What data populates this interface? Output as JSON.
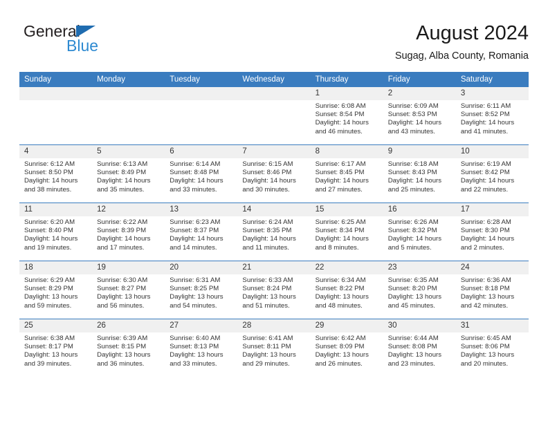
{
  "brand": {
    "name_line1": "General",
    "name_line2": "Blue",
    "triangle_color": "#1f6cb0",
    "blue_text_color": "#2e8ad1"
  },
  "header": {
    "title": "August 2024",
    "subtitle": "Sugag, Alba County, Romania",
    "header_bg_color": "#3a7cbf",
    "daynum_bg_color": "#f0f0f0"
  },
  "weekday_headers": [
    "Sunday",
    "Monday",
    "Tuesday",
    "Wednesday",
    "Thursday",
    "Friday",
    "Saturday"
  ],
  "weeks": [
    [
      {
        "day": "",
        "empty": true
      },
      {
        "day": "",
        "empty": true
      },
      {
        "day": "",
        "empty": true
      },
      {
        "day": "",
        "empty": true
      },
      {
        "day": "1",
        "sunrise": "Sunrise: 6:08 AM",
        "sunset": "Sunset: 8:54 PM",
        "daylight_line1": "Daylight: 14 hours",
        "daylight_line2": "and 46 minutes."
      },
      {
        "day": "2",
        "sunrise": "Sunrise: 6:09 AM",
        "sunset": "Sunset: 8:53 PM",
        "daylight_line1": "Daylight: 14 hours",
        "daylight_line2": "and 43 minutes."
      },
      {
        "day": "3",
        "sunrise": "Sunrise: 6:11 AM",
        "sunset": "Sunset: 8:52 PM",
        "daylight_line1": "Daylight: 14 hours",
        "daylight_line2": "and 41 minutes."
      }
    ],
    [
      {
        "day": "4",
        "sunrise": "Sunrise: 6:12 AM",
        "sunset": "Sunset: 8:50 PM",
        "daylight_line1": "Daylight: 14 hours",
        "daylight_line2": "and 38 minutes."
      },
      {
        "day": "5",
        "sunrise": "Sunrise: 6:13 AM",
        "sunset": "Sunset: 8:49 PM",
        "daylight_line1": "Daylight: 14 hours",
        "daylight_line2": "and 35 minutes."
      },
      {
        "day": "6",
        "sunrise": "Sunrise: 6:14 AM",
        "sunset": "Sunset: 8:48 PM",
        "daylight_line1": "Daylight: 14 hours",
        "daylight_line2": "and 33 minutes."
      },
      {
        "day": "7",
        "sunrise": "Sunrise: 6:15 AM",
        "sunset": "Sunset: 8:46 PM",
        "daylight_line1": "Daylight: 14 hours",
        "daylight_line2": "and 30 minutes."
      },
      {
        "day": "8",
        "sunrise": "Sunrise: 6:17 AM",
        "sunset": "Sunset: 8:45 PM",
        "daylight_line1": "Daylight: 14 hours",
        "daylight_line2": "and 27 minutes."
      },
      {
        "day": "9",
        "sunrise": "Sunrise: 6:18 AM",
        "sunset": "Sunset: 8:43 PM",
        "daylight_line1": "Daylight: 14 hours",
        "daylight_line2": "and 25 minutes."
      },
      {
        "day": "10",
        "sunrise": "Sunrise: 6:19 AM",
        "sunset": "Sunset: 8:42 PM",
        "daylight_line1": "Daylight: 14 hours",
        "daylight_line2": "and 22 minutes."
      }
    ],
    [
      {
        "day": "11",
        "sunrise": "Sunrise: 6:20 AM",
        "sunset": "Sunset: 8:40 PM",
        "daylight_line1": "Daylight: 14 hours",
        "daylight_line2": "and 19 minutes."
      },
      {
        "day": "12",
        "sunrise": "Sunrise: 6:22 AM",
        "sunset": "Sunset: 8:39 PM",
        "daylight_line1": "Daylight: 14 hours",
        "daylight_line2": "and 17 minutes."
      },
      {
        "day": "13",
        "sunrise": "Sunrise: 6:23 AM",
        "sunset": "Sunset: 8:37 PM",
        "daylight_line1": "Daylight: 14 hours",
        "daylight_line2": "and 14 minutes."
      },
      {
        "day": "14",
        "sunrise": "Sunrise: 6:24 AM",
        "sunset": "Sunset: 8:35 PM",
        "daylight_line1": "Daylight: 14 hours",
        "daylight_line2": "and 11 minutes."
      },
      {
        "day": "15",
        "sunrise": "Sunrise: 6:25 AM",
        "sunset": "Sunset: 8:34 PM",
        "daylight_line1": "Daylight: 14 hours",
        "daylight_line2": "and 8 minutes."
      },
      {
        "day": "16",
        "sunrise": "Sunrise: 6:26 AM",
        "sunset": "Sunset: 8:32 PM",
        "daylight_line1": "Daylight: 14 hours",
        "daylight_line2": "and 5 minutes."
      },
      {
        "day": "17",
        "sunrise": "Sunrise: 6:28 AM",
        "sunset": "Sunset: 8:30 PM",
        "daylight_line1": "Daylight: 14 hours",
        "daylight_line2": "and 2 minutes."
      }
    ],
    [
      {
        "day": "18",
        "sunrise": "Sunrise: 6:29 AM",
        "sunset": "Sunset: 8:29 PM",
        "daylight_line1": "Daylight: 13 hours",
        "daylight_line2": "and 59 minutes."
      },
      {
        "day": "19",
        "sunrise": "Sunrise: 6:30 AM",
        "sunset": "Sunset: 8:27 PM",
        "daylight_line1": "Daylight: 13 hours",
        "daylight_line2": "and 56 minutes."
      },
      {
        "day": "20",
        "sunrise": "Sunrise: 6:31 AM",
        "sunset": "Sunset: 8:25 PM",
        "daylight_line1": "Daylight: 13 hours",
        "daylight_line2": "and 54 minutes."
      },
      {
        "day": "21",
        "sunrise": "Sunrise: 6:33 AM",
        "sunset": "Sunset: 8:24 PM",
        "daylight_line1": "Daylight: 13 hours",
        "daylight_line2": "and 51 minutes."
      },
      {
        "day": "22",
        "sunrise": "Sunrise: 6:34 AM",
        "sunset": "Sunset: 8:22 PM",
        "daylight_line1": "Daylight: 13 hours",
        "daylight_line2": "and 48 minutes."
      },
      {
        "day": "23",
        "sunrise": "Sunrise: 6:35 AM",
        "sunset": "Sunset: 8:20 PM",
        "daylight_line1": "Daylight: 13 hours",
        "daylight_line2": "and 45 minutes."
      },
      {
        "day": "24",
        "sunrise": "Sunrise: 6:36 AM",
        "sunset": "Sunset: 8:18 PM",
        "daylight_line1": "Daylight: 13 hours",
        "daylight_line2": "and 42 minutes."
      }
    ],
    [
      {
        "day": "25",
        "sunrise": "Sunrise: 6:38 AM",
        "sunset": "Sunset: 8:17 PM",
        "daylight_line1": "Daylight: 13 hours",
        "daylight_line2": "and 39 minutes."
      },
      {
        "day": "26",
        "sunrise": "Sunrise: 6:39 AM",
        "sunset": "Sunset: 8:15 PM",
        "daylight_line1": "Daylight: 13 hours",
        "daylight_line2": "and 36 minutes."
      },
      {
        "day": "27",
        "sunrise": "Sunrise: 6:40 AM",
        "sunset": "Sunset: 8:13 PM",
        "daylight_line1": "Daylight: 13 hours",
        "daylight_line2": "and 33 minutes."
      },
      {
        "day": "28",
        "sunrise": "Sunrise: 6:41 AM",
        "sunset": "Sunset: 8:11 PM",
        "daylight_line1": "Daylight: 13 hours",
        "daylight_line2": "and 29 minutes."
      },
      {
        "day": "29",
        "sunrise": "Sunrise: 6:42 AM",
        "sunset": "Sunset: 8:09 PM",
        "daylight_line1": "Daylight: 13 hours",
        "daylight_line2": "and 26 minutes."
      },
      {
        "day": "30",
        "sunrise": "Sunrise: 6:44 AM",
        "sunset": "Sunset: 8:08 PM",
        "daylight_line1": "Daylight: 13 hours",
        "daylight_line2": "and 23 minutes."
      },
      {
        "day": "31",
        "sunrise": "Sunrise: 6:45 AM",
        "sunset": "Sunset: 8:06 PM",
        "daylight_line1": "Daylight: 13 hours",
        "daylight_line2": "and 20 minutes."
      }
    ]
  ]
}
